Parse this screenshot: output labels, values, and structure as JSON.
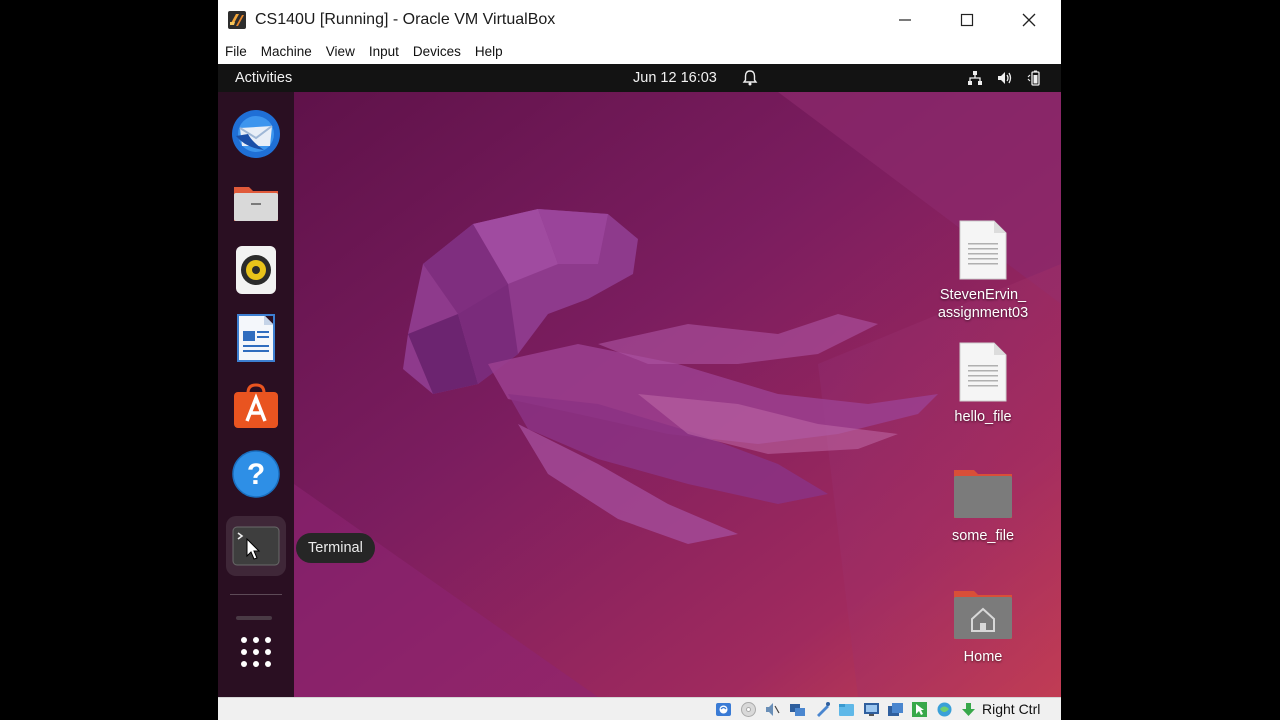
{
  "window": {
    "title": "CS140U [Running] - Oracle VM VirtualBox",
    "app_icon": "virtualbox-icon",
    "controls": [
      "minimize-icon",
      "maximize-icon",
      "close-icon"
    ]
  },
  "menubar": {
    "items": [
      "File",
      "Machine",
      "View",
      "Input",
      "Devices",
      "Help"
    ]
  },
  "guest": {
    "topbar": {
      "activities": "Activities",
      "clock": "Jun 12  16:03",
      "indicators": [
        "notification-bell-icon",
        "network-icon",
        "volume-icon",
        "battery-icon"
      ]
    },
    "dock": {
      "apps": [
        "thunderbird-icon",
        "files-icon",
        "rhythmbox-icon",
        "libreoffice-writer-icon",
        "app-center-icon",
        "help-icon",
        "terminal-icon"
      ],
      "show_apps": "app-grid-icon",
      "tooltip": "Terminal"
    },
    "desktop": {
      "items": [
        {
          "label_line1": "StevenErvin_",
          "label_line2": "assignment03",
          "icon": "text-file-icon"
        },
        {
          "label_line1": "hello_file",
          "label_line2": "",
          "icon": "text-file-icon"
        },
        {
          "label_line1": "some_file",
          "label_line2": "",
          "icon": "folder-icon"
        },
        {
          "label_line1": "Home",
          "label_line2": "",
          "icon": "home-folder-icon"
        }
      ]
    }
  },
  "statusbar": {
    "host_key": "Right Ctrl",
    "icons": [
      "hard-disk-icon",
      "optical-drive-icon",
      "audio-icon",
      "network-adapter-icon",
      "usb-icon",
      "shared-folders-icon",
      "display-icon",
      "recording-icon",
      "mouse-integration-icon",
      "keyboard-capture-icon",
      "guest-additions-icon"
    ]
  },
  "colors": {
    "topbar": "#131313",
    "dock": "#2a0f22",
    "wallpaper_primary": "#7a1c5e",
    "wallpaper_accent": "#c6404f",
    "titlebar": "#ffffff"
  }
}
